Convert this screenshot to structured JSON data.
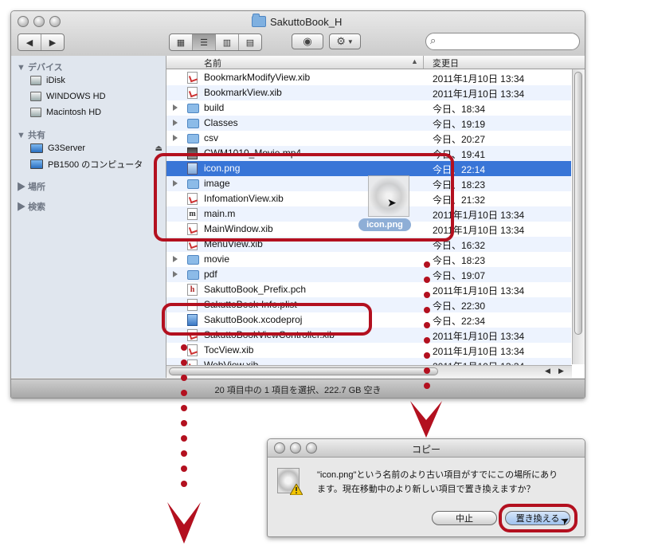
{
  "finder": {
    "title": "SakuttoBook_H",
    "sidebar": {
      "devices_header": "デバイス",
      "devices": [
        "iDisk",
        "WINDOWS HD",
        "Macintosh HD"
      ],
      "shared_header": "共有",
      "shared": [
        "G3Server",
        "PB1500 のコンピュータ"
      ],
      "places_header": "場所",
      "search_header": "検索"
    },
    "columns": {
      "name": "名前",
      "date": "変更日"
    },
    "files": [
      {
        "name": "BookmarkModifyView.xib",
        "date": "2011年1月10日 13:34"
      },
      {
        "name": "BookmarkView.xib",
        "date": "2011年1月10日 13:34"
      },
      {
        "name": "build",
        "date": "今日、18:34"
      },
      {
        "name": "Classes",
        "date": "今日、19:19"
      },
      {
        "name": "csv",
        "date": "今日、20:27"
      },
      {
        "name": "CWM1010_Movie.mp4",
        "date": "今日、19:41"
      },
      {
        "name": "icon.png",
        "date": "今日、22:14"
      },
      {
        "name": "image",
        "date": "今日、18:23"
      },
      {
        "name": "InfomationView.xib",
        "date": "今日、21:32"
      },
      {
        "name": "main.m",
        "date": "2011年1月10日 13:34"
      },
      {
        "name": "MainWindow.xib",
        "date": "2011年1月10日 13:34"
      },
      {
        "name": "MenuView.xib",
        "date": "今日、16:32"
      },
      {
        "name": "movie",
        "date": "今日、18:23"
      },
      {
        "name": "pdf",
        "date": "今日、19:07"
      },
      {
        "name": "SakuttoBook_Prefix.pch",
        "date": "2011年1月10日 13:34"
      },
      {
        "name": "SakuttoBook-Info.plist",
        "date": "今日、22:30"
      },
      {
        "name": "SakuttoBook.xcodeproj",
        "date": "今日、22:34"
      },
      {
        "name": "SakuttoBookViewController.xib",
        "date": "2011年1月10日 13:34"
      },
      {
        "name": "TocView.xib",
        "date": "2011年1月10日 13:34"
      },
      {
        "name": "WebView.xib",
        "date": "2011年1月10日 13:34"
      }
    ],
    "drag_label": "icon.png",
    "status": "20 項目中の 1 項目を選択、222.7 GB 空き"
  },
  "dialog": {
    "title": "コピー",
    "message_line1": "\"icon.png\"という名前のより古い項目がすでにこの場所にあり",
    "message_line2": "ます。現在移動中のより新しい項目で置き換えますか？",
    "cancel": "中止",
    "replace": "置き換える"
  },
  "colors": {
    "selection": "#3875d7",
    "annotation": "#b3101f"
  }
}
